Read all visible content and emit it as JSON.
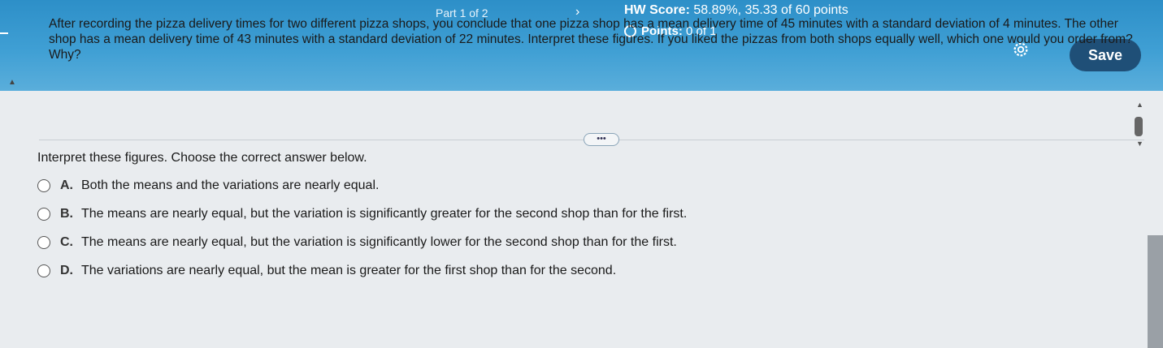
{
  "header": {
    "part": "Part 1 of 2",
    "next_arrow": "›",
    "hw_score_label": "HW Score:",
    "hw_score_value": "58.89%, 35.33 of 60 points",
    "points_label": "Points:",
    "points_value": "0 of 1",
    "save_label": "Save"
  },
  "question": {
    "text": "After recording the pizza delivery times for two different pizza shops, you conclude that one pizza shop has a mean delivery time of 45 minutes with a standard deviation of 4 minutes. The other shop has a mean delivery time of 43 minutes with a standard deviation of 22 minutes. Interpret these figures. If you liked the pizzas from both shops equally well, which one would you order from? Why?"
  },
  "expand_label": "•••",
  "prompt": "Interpret these figures. Choose the correct answer below.",
  "options": [
    {
      "letter": "A.",
      "text": "Both the means and the variations are nearly equal."
    },
    {
      "letter": "B.",
      "text": "The means are nearly equal, but the variation is significantly greater for the second shop than for the first."
    },
    {
      "letter": "C.",
      "text": "The means are nearly equal, but the variation is significantly lower for the second shop than for the first."
    },
    {
      "letter": "D.",
      "text": "The variations are nearly equal, but the mean is greater for the first shop than for the second."
    }
  ],
  "colors": {
    "header_blue": "#3f9fd4",
    "save_button": "#1f4f77"
  }
}
